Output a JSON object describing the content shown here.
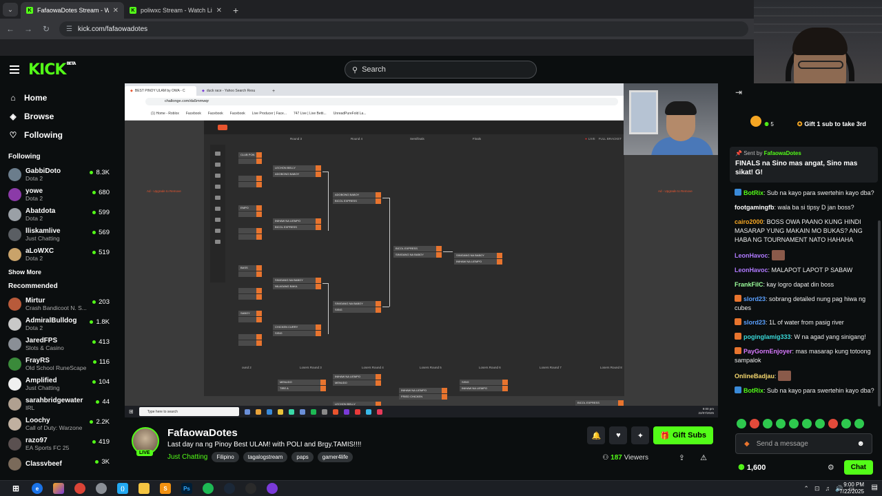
{
  "browser": {
    "tabs": [
      {
        "title": "FafaowaDotes Stream - Watch l",
        "active": true
      },
      {
        "title": "poliwxc Stream - Watch Live on",
        "active": false
      }
    ],
    "url": "kick.com/fafaowadotes"
  },
  "header": {
    "logo": "KICK",
    "logo_beta": "BETA",
    "search_placeholder": "Search"
  },
  "sidebar": {
    "nav": [
      {
        "label": "Home",
        "icon": "home-icon"
      },
      {
        "label": "Browse",
        "icon": "compass-icon"
      },
      {
        "label": "Following",
        "icon": "heart-icon"
      }
    ],
    "following_title": "Following",
    "following": [
      {
        "name": "GabbiDoto",
        "category": "Dota 2",
        "viewers": "8.3K",
        "color": "#6b7d8c"
      },
      {
        "name": "yowe",
        "category": "Dota 2",
        "viewers": "680",
        "color": "#8b3aa8"
      },
      {
        "name": "Abatdota",
        "category": "Dota 2",
        "viewers": "599",
        "color": "#9aa0a6"
      },
      {
        "name": "lliskamlive",
        "category": "Just Chatting",
        "viewers": "569",
        "color": "#5a5e63"
      },
      {
        "name": "aLoWXC",
        "category": "Dota 2",
        "viewers": "519",
        "color": "#c9a36a"
      }
    ],
    "show_more": "Show More",
    "recommended_title": "Recommended",
    "recommended": [
      {
        "name": "Mirtur",
        "category": "Crash Bandicoot N. S...",
        "viewers": "203",
        "color": "#b85a3a"
      },
      {
        "name": "AdmiralBulldog",
        "category": "Dota 2",
        "viewers": "1.8K",
        "color": "#c8c8c8"
      },
      {
        "name": "JaredFPS",
        "category": "Slots & Casino",
        "viewers": "413",
        "color": "#8a8f96"
      },
      {
        "name": "FrayRS",
        "category": "Old School RuneScape",
        "viewers": "116",
        "color": "#3a8a3a"
      },
      {
        "name": "Amplified",
        "category": "Just Chatting",
        "viewers": "104",
        "color": "#f0f0f0"
      },
      {
        "name": "sarahbridgewater",
        "category": "IRL",
        "viewers": "44",
        "color": "#b0a090"
      },
      {
        "name": "Loochy",
        "category": "Call of Duty: Warzone",
        "viewers": "2.2K",
        "color": "#c0b0a0"
      },
      {
        "name": "razo97",
        "category": "EA Sports FC 25",
        "viewers": "419",
        "color": "#5a5050"
      },
      {
        "name": "Classvbeef",
        "category": "",
        "viewers": "3K",
        "color": "#7a6a5a"
      }
    ]
  },
  "screen": {
    "tabs": [
      "BEST PINOY ULAM by OWA - C",
      "duck race - Yahoo Search Resu"
    ],
    "url": "challonge.com/da5mmwqr",
    "bookmarks": [
      "(1) Home - Roblox",
      "Facebook",
      "Facebook",
      "Facebook",
      "Live Producer | Face...",
      "747 Live | Live Betti...",
      "UnreadPureFold La..."
    ],
    "rounds": [
      "Round 3",
      "Round 4",
      "Semifinals",
      "Finals"
    ],
    "live_label": "LIVE",
    "full_bracket": "FULL BRACKET",
    "upsell_left": "Ad - Upgrade to Remove",
    "upsell_right": "Ad - Upgrade to Remove",
    "losers_rounds": [
      "ound 2",
      "Losers Round 3",
      "Losers Round 4",
      "Losers Round 5",
      "Losers Round 6",
      "Losers Round 7",
      "Losers Round 8"
    ],
    "matches": {
      "r2": [
        "CLUB PON",
        "",
        "EMPO",
        "",
        "BASS",
        "",
        "SABOY",
        "",
        "ACA",
        "",
        "SBEY",
        "",
        "HOTDOG",
        ""
      ],
      "r3": [
        [
          "LECHON BELLY",
          "ADOBONG BABOY"
        ],
        [
          "INIHAW NA LIEMPO",
          "BICOL EXPRESS"
        ],
        [
          "SINIGANG NA BABOY",
          "NILAGANG BAKA"
        ],
        [
          "CHICKEN CURRY",
          "SISIG"
        ]
      ],
      "r4": [
        [
          "ADOBONG BABOY",
          "BICOL EXPRESS"
        ],
        [
          "SINIGANG NA BABOY",
          "SISIG"
        ]
      ],
      "semi": [
        [
          "BICOL EXPRESS",
          "SINIGANG NA BABOY"
        ]
      ],
      "final": [
        [
          "SINIGANG NA BABOY",
          "INIHAW NA LIEMPO"
        ]
      ],
      "losers": [
        [
          "MENUDO",
          "TIRE A"
        ],
        [
          "INIHAW NA LIEMPO",
          "MENUDO"
        ],
        [
          "INIHAW NA LIEMPO",
          "FRIED CHICKEN"
        ],
        [
          "SISIG",
          "INIHAW NA LIEMPO"
        ],
        [
          "LECHON BELLY",
          ""
        ],
        [
          "BICOL EXPRESS",
          ""
        ]
      ]
    },
    "taskbar_search": "Type here to search",
    "clock_time": "9:00 pm",
    "clock_date": "22/07/2025"
  },
  "stream": {
    "name": "FafaowaDotes",
    "live": "LIVE",
    "title": "Last day na ng Pinoy Best ULAM! with POLI and Brgy.TAMIS!!!!",
    "category": "Just Chatting",
    "tags": [
      "Filipino",
      "tagalogstream",
      "paps",
      "gamer4life"
    ],
    "viewers": "187",
    "viewers_label": "Viewers",
    "gift_label": "Gift Subs"
  },
  "chat": {
    "gift_count": "5",
    "gift_cta": "Gift 1 sub to take 3rd",
    "pinned_by_label": "Sent by",
    "pinned_by": "FafaowaDotes",
    "pinned_text": "FINALS na Sino mas angat, Sino mas sikat! G!",
    "messages": [
      {
        "user": "BotRix",
        "color": "#53fc18",
        "text": "Sub na kayo para swertehin kayo dba?",
        "badge": "#3a8ad8"
      },
      {
        "user": "footgamingfb",
        "color": "#ffffff",
        "text": "wala ba si tipsy D jan boss?",
        "badge": ""
      },
      {
        "user": "cairo2000",
        "color": "#f5a623",
        "text": "BOSS OWA PAANO KUNG HINDI MASARAP YUNG MAKAIN MO BUKAS? ANG HABA NG TOURNAMENT NATO HAHAHA",
        "badge": ""
      },
      {
        "user": "LeonHavoc",
        "color": "#b07aff",
        "text": "",
        "badge": "",
        "emote": true
      },
      {
        "user": "LeonHavoc",
        "color": "#b07aff",
        "text": "MALAPOT LAPOT P SABAW",
        "badge": ""
      },
      {
        "user": "FrankFilC",
        "color": "#9cff9c",
        "text": "kay logro dapat din boss",
        "badge": ""
      },
      {
        "user": "slord23",
        "color": "#5aa0ff",
        "text": "sobrang detailed nung pag hiwa ng cubes",
        "badge": "#e8742e"
      },
      {
        "user": "slord23",
        "color": "#5aa0ff",
        "text": "1L of water from pasig river",
        "badge": "#e8742e"
      },
      {
        "user": "poginglamig333",
        "color": "#3ad8d8",
        "text": "W na agad yang sinigang!",
        "badge": "#e8742e"
      },
      {
        "user": "PayGornEnjoyer",
        "color": "#d87aff",
        "text": "mas masarap kung totoong sampalok",
        "badge": "#e8742e"
      },
      {
        "user": "OnlineBadjau",
        "color": "#f5d76e",
        "text": "",
        "badge": "",
        "emote": true
      },
      {
        "user": "BotRix",
        "color": "#53fc18",
        "text": "Sub na kayo para swertehin kayo dba?",
        "badge": "#3a8ad8"
      }
    ],
    "input_placeholder": "Send a message",
    "points": "1,600",
    "chat_button": "Chat"
  },
  "taskbar": {
    "time": "9:00 PM",
    "date": "7/22/2025"
  }
}
